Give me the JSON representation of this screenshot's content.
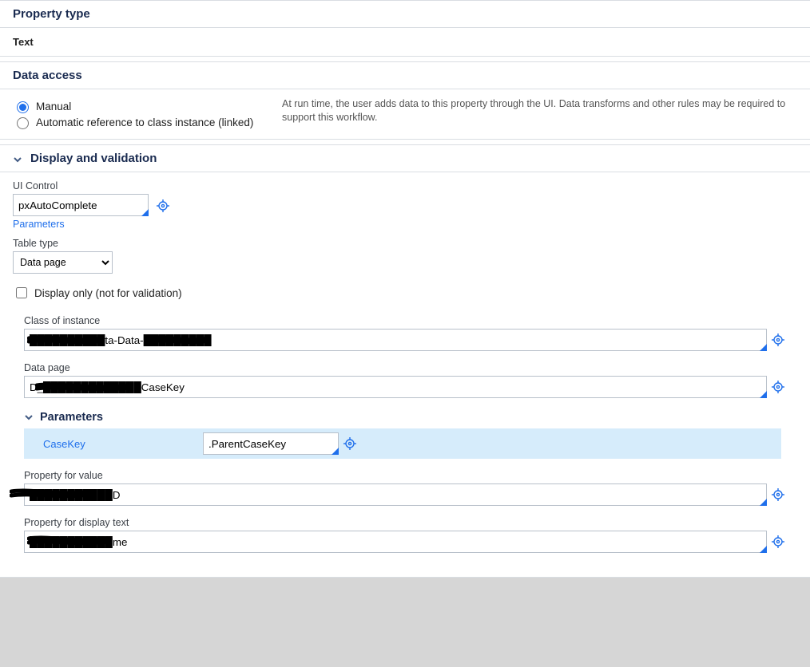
{
  "property_type": {
    "title": "Property type",
    "value": "Text"
  },
  "data_access": {
    "title": "Data access",
    "options": {
      "manual": "Manual",
      "linked": "Automatic reference to class instance (linked)"
    },
    "selected": "manual",
    "description": "At run time, the user adds data to this property through the UI. Data transforms and other rules may be required to support this workflow."
  },
  "display_validation": {
    "title": "Display and validation",
    "ui_control": {
      "label": "UI Control",
      "value": "pxAutoComplete",
      "params_link": "Parameters"
    },
    "table_type": {
      "label": "Table type",
      "selected": "Data page",
      "options": [
        "Data page"
      ]
    },
    "display_only": {
      "label": "Display only (not for validation)",
      "checked": false
    },
    "class_of_instance": {
      "label": "Class of instance",
      "value": "██████████ta-Data-█████████"
    },
    "data_page": {
      "label": "Data page",
      "value": "D_█████████████CaseKey"
    },
    "parameters": {
      "title": "Parameters",
      "rows": [
        {
          "name": "CaseKey",
          "value": ".ParentCaseKey"
        }
      ]
    },
    "property_for_value": {
      "label": "Property for value",
      "value": "███████████D"
    },
    "property_for_display": {
      "label": "Property for display text",
      "value": "███████████me"
    }
  }
}
